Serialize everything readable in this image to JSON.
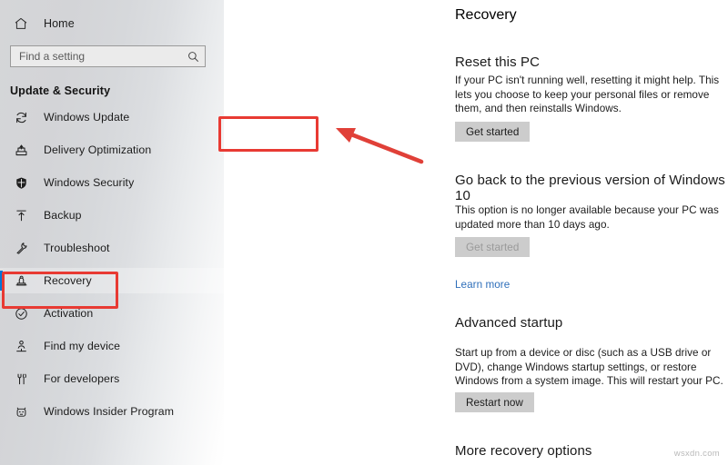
{
  "sidebar": {
    "home": {
      "label": "Home",
      "icon": "home-icon"
    },
    "search": {
      "value": "",
      "placeholder": "Find a setting",
      "icon": "search-icon"
    },
    "section_title": "Update & Security",
    "items": [
      {
        "label": "Windows Update",
        "icon": "refresh-icon",
        "selected": false
      },
      {
        "label": "Delivery Optimization",
        "icon": "delivery-box-icon",
        "selected": false
      },
      {
        "label": "Windows Security",
        "icon": "shield-icon",
        "selected": false
      },
      {
        "label": "Backup",
        "icon": "upload-arrow-icon",
        "selected": false
      },
      {
        "label": "Troubleshoot",
        "icon": "wrench-icon",
        "selected": false
      },
      {
        "label": "Recovery",
        "icon": "recovery-pc-icon",
        "selected": true
      },
      {
        "label": "Activation",
        "icon": "check-circle-icon",
        "selected": false
      },
      {
        "label": "Find my device",
        "icon": "person-pin-icon",
        "selected": false
      },
      {
        "label": "For developers",
        "icon": "dev-tools-icon",
        "selected": false
      },
      {
        "label": "Windows Insider Program",
        "icon": "insider-cat-icon",
        "selected": false
      }
    ]
  },
  "main": {
    "page_title": "Recovery",
    "sections": [
      {
        "heading": "Reset this PC",
        "body": "If your PC isn't running well, resetting it might help. This lets you choose to keep your personal files or remove them, and then reinstalls Windows.",
        "button": "Get started"
      },
      {
        "heading": "Go back to the previous version of Windows 10",
        "body": "This option is no longer available because your PC was updated more than 10 days ago.",
        "button": "Get started",
        "link": "Learn more"
      },
      {
        "heading": "Advanced startup",
        "body": "Start up from a device or disc (such as a USB drive or DVD), change Windows startup settings, or restore Windows from a system image. This will restart your PC.",
        "button": "Restart now"
      },
      {
        "heading": "More recovery options"
      }
    ]
  },
  "annotations": {
    "color": "#e83a33",
    "accent": "#0078d7",
    "link_color": "#2f6fba"
  },
  "watermark": "wsxdn.com"
}
